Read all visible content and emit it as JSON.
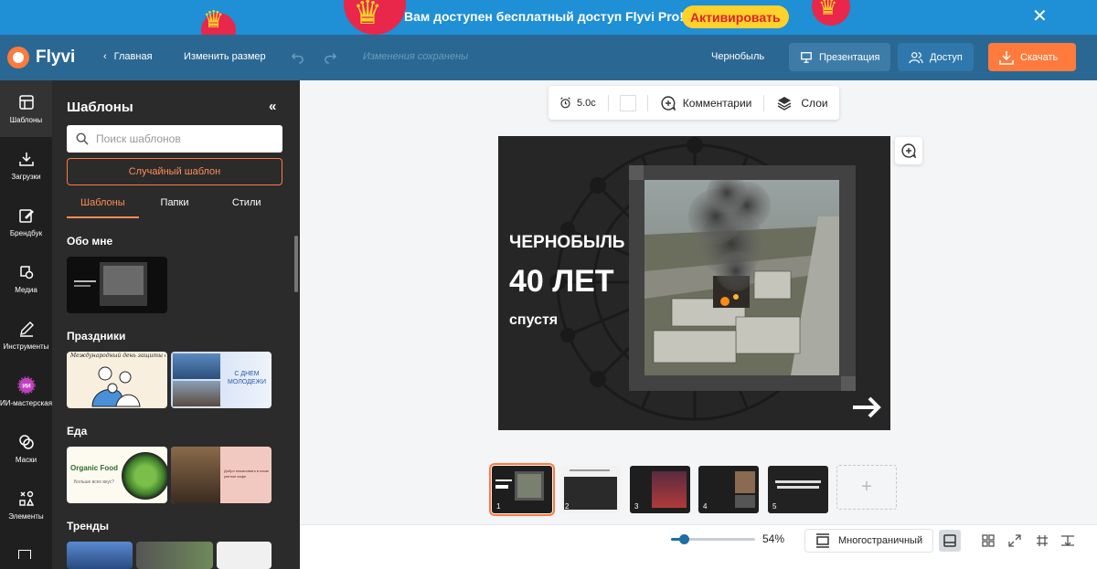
{
  "promo": {
    "text": "Вам доступен бесплатный доступ Flyvi Pro!",
    "button": "Активировать",
    "close_glyph": "✕"
  },
  "header": {
    "logo": "Flyvi",
    "back_label": "Главная",
    "resize_label": "Изменить размер",
    "saved_status": "Изменения сохранены",
    "project_name": "Чернобыль",
    "presentation_label": "Презентация",
    "access_label": "Доступ",
    "download_label": "Скачать"
  },
  "rail": [
    {
      "label": "Шаблоны",
      "icon": "layout-icon",
      "active": true
    },
    {
      "label": "Загрузки",
      "icon": "upload-icon",
      "active": false
    },
    {
      "label": "Брендбук",
      "icon": "brandbook-icon",
      "active": false
    },
    {
      "label": "Медиа",
      "icon": "media-icon",
      "active": false
    },
    {
      "label": "Инструменты",
      "icon": "pencil-icon",
      "active": false
    },
    {
      "label": "ИИ-мастерская",
      "icon": "ai-icon",
      "active": false
    },
    {
      "label": "Маски",
      "icon": "mask-icon",
      "active": false
    },
    {
      "label": "Элементы",
      "icon": "elements-icon",
      "active": false
    }
  ],
  "panel": {
    "title": "Шаблоны",
    "collapse_glyph": "«",
    "search_placeholder": "Поиск шаблонов",
    "random_button": "Случайный шаблон",
    "tabs": [
      "Шаблоны",
      "Папки",
      "Стили"
    ],
    "sections": [
      "Обо мне",
      "Праздники",
      "Еда",
      "Тренды"
    ],
    "thumb_texts": {
      "holiday_1": "Международный день защиты детей",
      "holiday_2": "С ДНЕМ МОЛОДЕЖИ",
      "food_1": "Organic Food",
      "food_1_sub": "Больше всех вкус?",
      "food_2": "Добро пожаловать в наше уютное кафе"
    }
  },
  "canvas_toolbar": {
    "duration": "5.0с",
    "comments_label": "Комментарии",
    "layers_label": "Слои"
  },
  "slide": {
    "line1": "ЧЕРНОБЫЛЬ",
    "line2": "40 ЛЕТ",
    "line3": "спустя"
  },
  "pages": [
    {
      "num": "1",
      "active": true
    },
    {
      "num": "2",
      "active": false
    },
    {
      "num": "3",
      "active": false
    },
    {
      "num": "4",
      "active": false
    },
    {
      "num": "5",
      "active": false
    }
  ],
  "bottom": {
    "zoom": "54%",
    "zoom_fraction": 0.15,
    "multipage_label": "Многостраничный",
    "add_page_glyph": "+"
  },
  "colors": {
    "accent": "#ff7a3d",
    "header_bg": "#2a6893",
    "promo_bg": "#1f8fd6",
    "panel_bg": "#2b2b2b",
    "rail_bg": "#1f1f1f"
  }
}
